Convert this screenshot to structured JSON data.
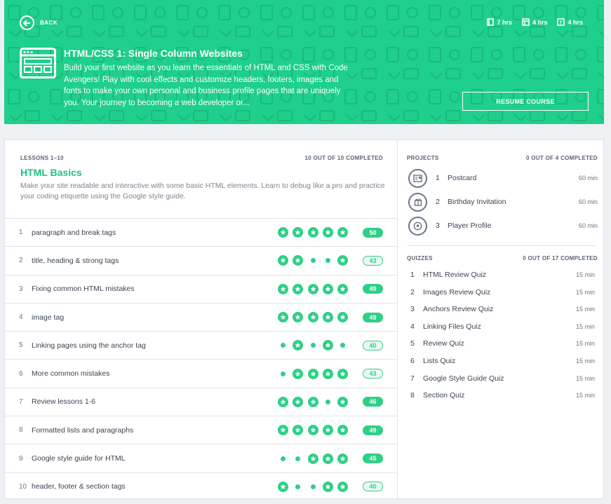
{
  "header": {
    "back_label": "BACK",
    "stats": [
      {
        "icon": "book-icon",
        "value": "7 hrs"
      },
      {
        "icon": "layout-icon",
        "value": "4 hrs"
      },
      {
        "icon": "quiz-icon",
        "value": "4 hrs"
      }
    ],
    "course_title": "HTML/CSS 1: Single Column Websites",
    "course_description": "Build your first website as you learn the essentials of HTML and CSS with Code Avengers! Play with cool effects and customize headers, footers, images and fonts to make your own personal and business profile pages that are uniquely you. Your journey to becoming a web developer or...",
    "resume_label": "RESUME COURSE",
    "accent_color": "#1fcf8c"
  },
  "lessons": {
    "range_label": "LESSONS 1–10",
    "completed_label": "10 OUT OF 10 COMPLETED",
    "title": "HTML Basics",
    "description": "Make your site readable and interactive with some basic HTML elements. Learn to debug like a pro and practice your coding etiquette using the Google style guide.",
    "items": [
      {
        "num": "1",
        "name": "paragraph and break tags",
        "stars": [
          1,
          1,
          1,
          1,
          1
        ],
        "score": "50",
        "full": true
      },
      {
        "num": "2",
        "name": "title, heading & strong tags",
        "stars": [
          1,
          1,
          0,
          0,
          1
        ],
        "score": "43",
        "full": false
      },
      {
        "num": "3",
        "name": "Fixing common HTML mistakes",
        "stars": [
          1,
          1,
          1,
          1,
          1
        ],
        "score": "49",
        "full": true
      },
      {
        "num": "4",
        "name": "image tag",
        "stars": [
          1,
          1,
          1,
          1,
          1
        ],
        "score": "49",
        "full": true
      },
      {
        "num": "5",
        "name": "Linking pages using the anchor tag",
        "stars": [
          0,
          1,
          0,
          1,
          0
        ],
        "score": "40",
        "full": false
      },
      {
        "num": "6",
        "name": "More common mistakes",
        "stars": [
          0,
          1,
          1,
          1,
          1
        ],
        "score": "43",
        "full": false
      },
      {
        "num": "7",
        "name": "Review lessons 1-6",
        "stars": [
          1,
          1,
          1,
          0,
          1
        ],
        "score": "46",
        "full": true
      },
      {
        "num": "8",
        "name": "Formatted lists and paragraphs",
        "stars": [
          1,
          1,
          1,
          1,
          1
        ],
        "score": "49",
        "full": true
      },
      {
        "num": "9",
        "name": "Google style guide for HTML",
        "stars": [
          0,
          0,
          1,
          1,
          1
        ],
        "score": "45",
        "full": true
      },
      {
        "num": "10",
        "name": "header, footer & section tags",
        "stars": [
          1,
          0,
          0,
          1,
          1
        ],
        "score": "40",
        "full": false
      }
    ]
  },
  "projects": {
    "label": "PROJECTS",
    "completed_label": "0 OUT OF 4 COMPLETED",
    "items": [
      {
        "num": "1",
        "name": "Postcard",
        "time": "60 min",
        "icon": "postcard-icon"
      },
      {
        "num": "2",
        "name": "Birthday Invitation",
        "time": "60 min",
        "icon": "gift-icon"
      },
      {
        "num": "3",
        "name": "Player Profile",
        "time": "60 min",
        "icon": "ball-icon"
      }
    ]
  },
  "quizzes": {
    "label": "QUIZZES",
    "completed_label": "0 OUT OF 17 COMPLETED",
    "items": [
      {
        "num": "1",
        "name": "HTML Review Quiz",
        "time": "15 min"
      },
      {
        "num": "2",
        "name": "Images Review Quiz",
        "time": "15 min"
      },
      {
        "num": "3",
        "name": "Anchors Review Quiz",
        "time": "15 min"
      },
      {
        "num": "4",
        "name": "Linking Files Quiz",
        "time": "15 min"
      },
      {
        "num": "5",
        "name": "Review Quiz",
        "time": "15 min"
      },
      {
        "num": "6",
        "name": "Lists Quiz",
        "time": "15 min"
      },
      {
        "num": "7",
        "name": "Google Style Guide Quiz",
        "time": "15 min"
      },
      {
        "num": "8",
        "name": "Section Quiz",
        "time": "15 min"
      }
    ]
  }
}
